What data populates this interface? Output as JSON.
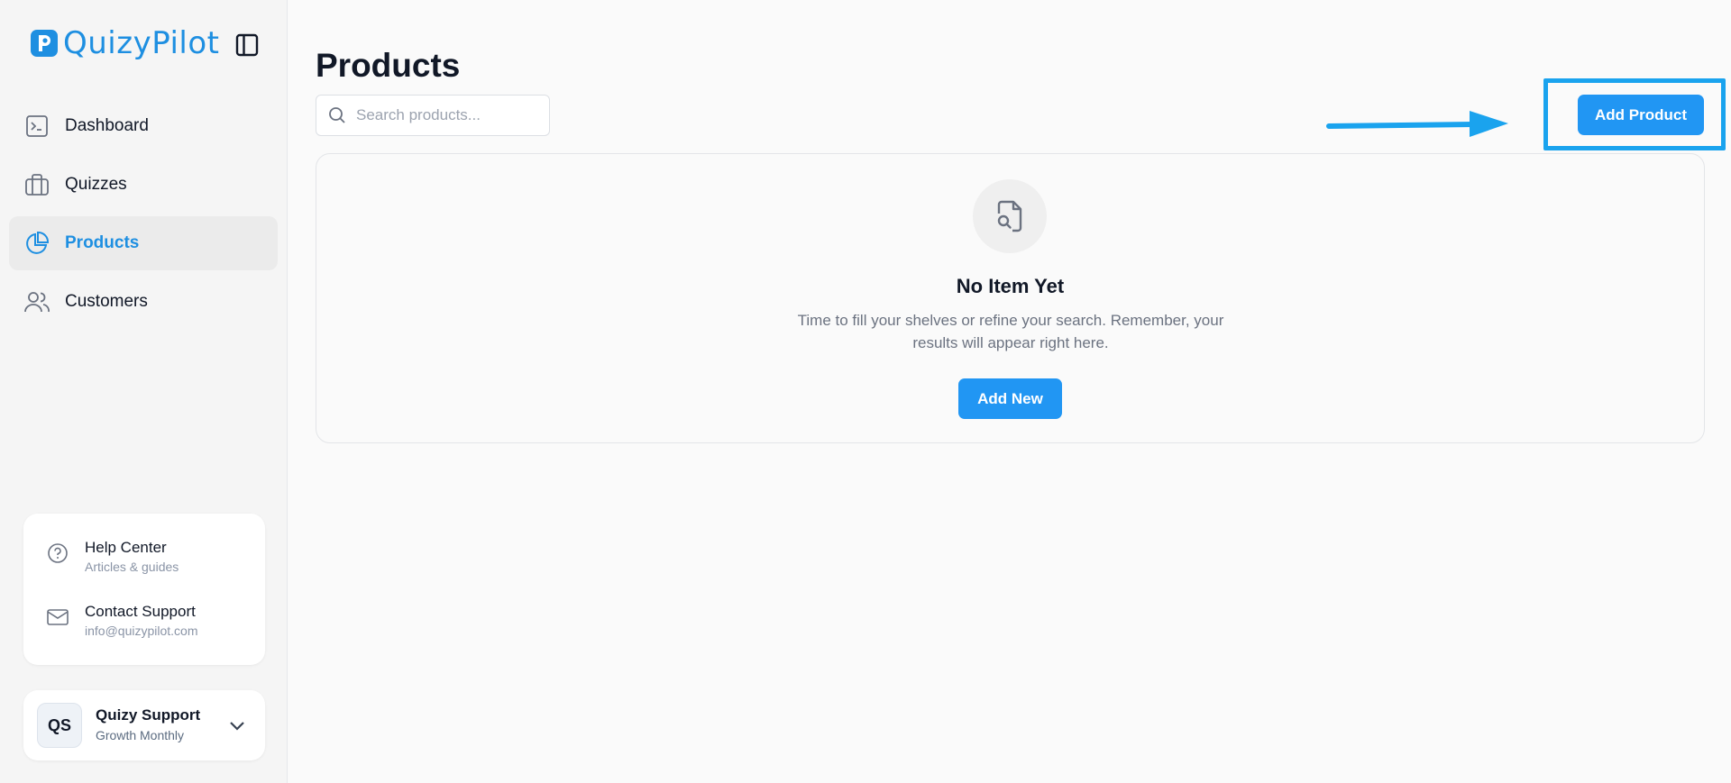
{
  "brand": {
    "name": "QuizyPilot",
    "letter": "P"
  },
  "sidebar": {
    "items": [
      {
        "label": "Dashboard",
        "icon": "terminal-icon"
      },
      {
        "label": "Quizzes",
        "icon": "briefcase-icon"
      },
      {
        "label": "Products",
        "icon": "pie-chart-icon",
        "active": true
      },
      {
        "label": "Customers",
        "icon": "users-icon"
      }
    ],
    "help": {
      "help_center_title": "Help Center",
      "help_center_sub": "Articles & guides",
      "contact_title": "Contact Support",
      "contact_sub": "info@quizypilot.com"
    },
    "user": {
      "initials": "QS",
      "name": "Quizy Support",
      "plan": "Growth Monthly"
    }
  },
  "main": {
    "title": "Products",
    "search": {
      "placeholder": "Search products...",
      "value": ""
    },
    "add_product_label": "Add Product",
    "empty": {
      "title": "No Item Yet",
      "description": "Time to fill your shelves or refine your search. Remember, your results will appear right here.",
      "add_new_label": "Add New"
    }
  },
  "colors": {
    "accent": "#2196f3",
    "brand": "#1e8fe1",
    "annotation": "#1aa3ee",
    "sidebar_bg": "#f5f5f5",
    "page_bg": "#fafafa"
  }
}
